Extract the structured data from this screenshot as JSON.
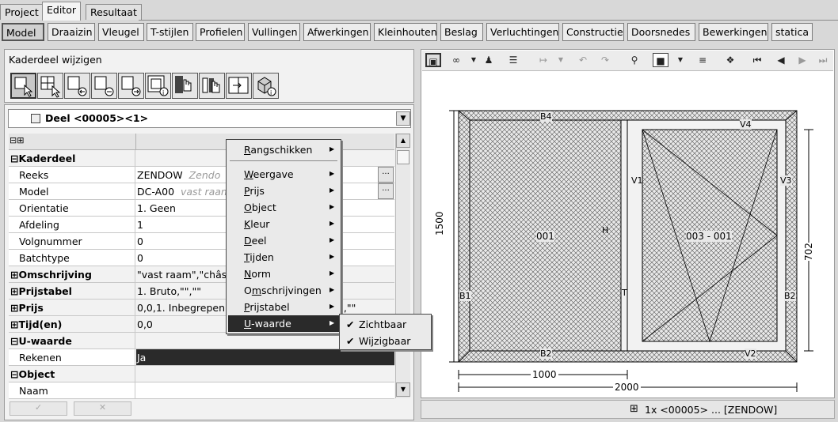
{
  "tabs": [
    "Project",
    "Editor",
    "Resultaat"
  ],
  "modules": [
    "Model",
    "Draaizin",
    "Vleugel",
    "T-stijlen",
    "Profielen",
    "Vullingen",
    "Afwerkingen",
    "Kleinhouten",
    "Beslag",
    "Verluchtingen",
    "Constructie",
    "Doorsnedes",
    "Bewerkingen",
    "statica"
  ],
  "left_panel": {
    "title": "Kaderdeel wijzigen",
    "tool_icons": [
      "select-frame-icon",
      "grid-select-icon",
      "add-left-icon",
      "remove-icon",
      "add-right-icon",
      "frame-info-icon",
      "hand-tool-icon",
      "split-hand-icon",
      "move-icon",
      "cube-info-icon"
    ],
    "dropdown_value": "Deel <00005><1>",
    "grid_header": "⊟⊞"
  },
  "properties": [
    {
      "name": "Kaderdeel",
      "value": "",
      "group": true,
      "exp": "⊟"
    },
    {
      "name": "Reeks",
      "value": "ZENDOW",
      "hint": "Zendo",
      "button": "..."
    },
    {
      "name": "Model",
      "value": "DC-A00",
      "hint": "vast raam",
      "button": "..."
    },
    {
      "name": "Orientatie",
      "value": "1. Geen"
    },
    {
      "name": "Afdeling",
      "value": "1"
    },
    {
      "name": "Volgnummer",
      "value": "0"
    },
    {
      "name": "Batchtype",
      "value": "0"
    },
    {
      "name": "Omschrijving",
      "value": "\"vast raam\",\"châss",
      "group": true,
      "exp": "⊞"
    },
    {
      "name": "Prijstabel",
      "value": "1. Bruto,\"\",\"\"",
      "group": true,
      "exp": "⊞"
    },
    {
      "name": "Prijs",
      "value": "0,0,1. Inbegrepen,0",
      "tail": "d,\"\"",
      "group": true,
      "exp": "⊞"
    },
    {
      "name": "Tijd(en)",
      "value": "0,0",
      "group": true,
      "exp": "⊞"
    },
    {
      "name": "U-waarde",
      "value": "",
      "group": true,
      "exp": "⊟"
    },
    {
      "name": "Rekenen",
      "value": "Ja",
      "selected": true
    },
    {
      "name": "Object",
      "value": "",
      "group": true,
      "exp": "⊟"
    },
    {
      "name": "Naam",
      "value": ""
    }
  ],
  "bottom_buttons": [
    "✓",
    "✕"
  ],
  "context_menu": {
    "items": [
      "Rangschikken",
      "Weergave",
      "Prijs",
      "Object",
      "Kleur",
      "Deel",
      "Tijden",
      "Norm",
      "Omschrijvingen",
      "Prijstabel",
      "U-waarde"
    ],
    "accel": [
      "R",
      "W",
      "P",
      "O",
      "K",
      "D",
      "T",
      "N",
      "m",
      "P",
      "U"
    ],
    "highlighted": "U-waarde"
  },
  "submenu": {
    "items": [
      "Zichtbaar",
      "Wijzigbaar"
    ],
    "checked": [
      true,
      true
    ]
  },
  "drawing": {
    "labels": {
      "top": "B4",
      "bottom": "B2",
      "left": "B1",
      "right": "B2",
      "sash_top": "V4",
      "sash_bottom": "V2",
      "sash_left": "V1",
      "sash_right": "V3",
      "mullion": "T",
      "left_pane": "001",
      "right_pane": "003 - 001",
      "mid": "H"
    },
    "dims": {
      "height": "1500",
      "sash_height": "702",
      "left_width": "1000",
      "total_width": "2000"
    }
  },
  "status_bar": "1x <00005> ... [ZENDOW]"
}
